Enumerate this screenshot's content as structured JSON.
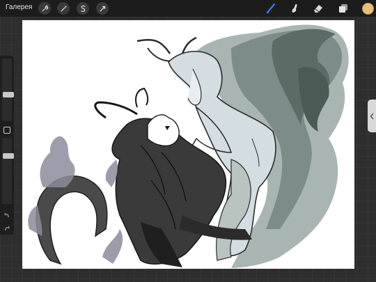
{
  "topbar": {
    "gallery_label": "Галерея",
    "action_icons": [
      "wrench-icon",
      "magic-wand-icon",
      "selection-s-icon",
      "transform-arrow-icon"
    ],
    "tools": [
      "brush-icon",
      "smudge-icon",
      "eraser-icon",
      "layers-icon"
    ],
    "active_tool": "brush-icon",
    "active_tool_color": "#3f7df0",
    "current_color": "#e8c07a"
  },
  "sidebar": {
    "brush_size_level": 0.2,
    "opacity_level": 0.2,
    "icons": [
      "modify-square-icon",
      "undo-icon",
      "redo-icon"
    ]
  },
  "canvas": {
    "background": "#ffffff",
    "palette": {
      "ink": "#1f1f1f",
      "shadow": "#3d3d3d",
      "skin": "#d3dde2",
      "hair": "#5b6b66",
      "smoke": "#a9b5b2",
      "flame": "#8c8c9c"
    }
  }
}
